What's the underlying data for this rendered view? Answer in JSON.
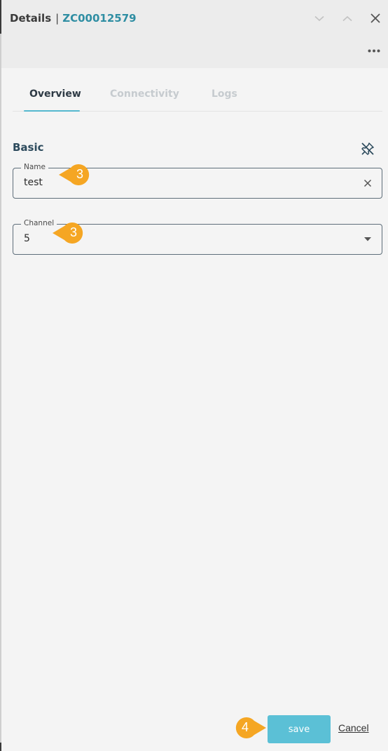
{
  "header": {
    "title": "Details",
    "separator": "|",
    "record_id": "ZC00012579"
  },
  "tabs": [
    {
      "label": "Overview",
      "active": true
    },
    {
      "label": "Connectivity",
      "active": false
    },
    {
      "label": "Logs",
      "active": false
    }
  ],
  "section": {
    "title": "Basic"
  },
  "fields": {
    "name": {
      "label": "Name",
      "value": "test"
    },
    "channel": {
      "label": "Channel",
      "value": "5"
    }
  },
  "callouts": {
    "name_step": "3",
    "channel_step": "3",
    "save_step": "4"
  },
  "footer": {
    "save_label": "save",
    "cancel_label": "Cancel"
  },
  "colors": {
    "accent": "#5bc0d6",
    "id_text": "#2f8ea3",
    "callout": "#f5a623"
  },
  "icons": [
    "chevron-down-icon",
    "chevron-up-icon",
    "close-icon",
    "more-icon",
    "unpin-icon",
    "clear-icon",
    "dropdown-arrow-icon"
  ]
}
